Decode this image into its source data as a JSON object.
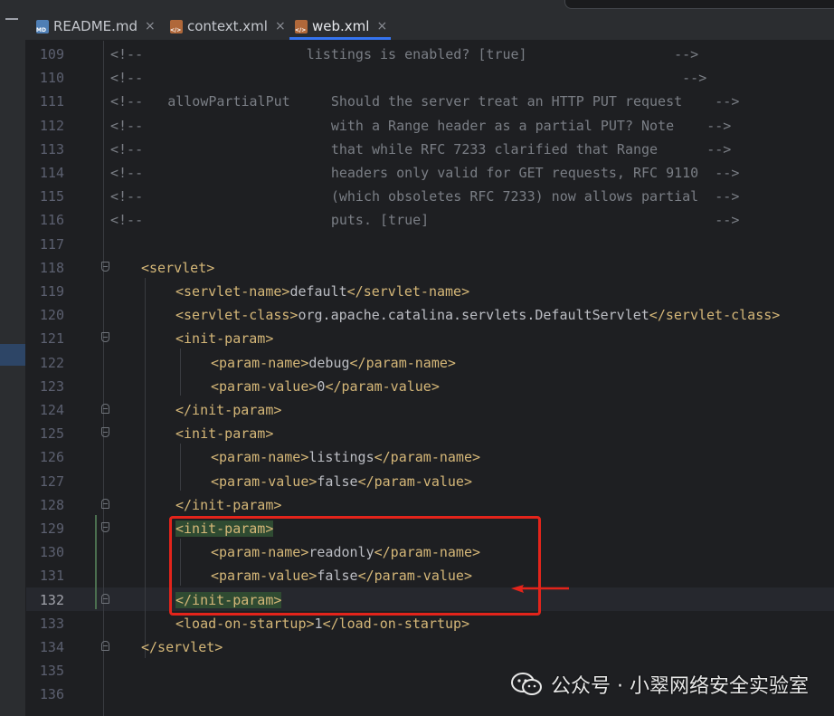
{
  "tabs": [
    {
      "label": "README.md",
      "icon": "markdown-file-icon",
      "badge": "MD",
      "color": "#6aa1d8"
    },
    {
      "label": "context.xml",
      "icon": "xml-file-icon",
      "badge": "</>",
      "color": "#c77b3b"
    },
    {
      "label": "web.xml",
      "icon": "xml-file-icon",
      "badge": "</>",
      "color": "#c77b3b",
      "active": true
    }
  ],
  "lines": [
    {
      "n": "109",
      "c": "<!--                    listings is enabled? [true]                  -->"
    },
    {
      "n": "110",
      "c": "<!--                                                                  -->"
    },
    {
      "n": "111",
      "c": "<!--   allowPartialPut     Should the server treat an HTTP PUT request    -->"
    },
    {
      "n": "112",
      "c": "<!--                       with a Range header as a partial PUT? Note    -->"
    },
    {
      "n": "113",
      "c": "<!--                       that while RFC 7233 clarified that Range      -->"
    },
    {
      "n": "114",
      "c": "<!--                       headers only valid for GET requests, RFC 9110  -->"
    },
    {
      "n": "115",
      "c": "<!--                       (which obsoletes RFC 7233) now allows partial  -->"
    },
    {
      "n": "116",
      "c": "<!--                       puts. [true]                                   -->"
    },
    {
      "n": "117",
      "c": ""
    },
    {
      "n": "118",
      "c": "<servlet>"
    },
    {
      "n": "119",
      "c": "<servlet-name>default</servlet-name>"
    },
    {
      "n": "120",
      "c": "<servlet-class>org.apache.catalina.servlets.DefaultServlet</servlet-class>"
    },
    {
      "n": "121",
      "c": "<init-param>"
    },
    {
      "n": "122",
      "c": "<param-name>debug</param-name>"
    },
    {
      "n": "123",
      "c": "<param-value>0</param-value>"
    },
    {
      "n": "124",
      "c": "</init-param>"
    },
    {
      "n": "125",
      "c": "<init-param>"
    },
    {
      "n": "126",
      "c": "<param-name>listings</param-name>"
    },
    {
      "n": "127",
      "c": "<param-value>false</param-value>"
    },
    {
      "n": "128",
      "c": "</init-param>"
    },
    {
      "n": "129",
      "c": "<init-param>"
    },
    {
      "n": "130",
      "c": "<param-name>readonly</param-name>"
    },
    {
      "n": "131",
      "c": "<param-value>false</param-value>"
    },
    {
      "n": "132",
      "c": "</init-param>"
    },
    {
      "n": "133",
      "c": "<load-on-startup>1</load-on-startup>"
    },
    {
      "n": "134",
      "c": "</servlet>"
    },
    {
      "n": "135",
      "c": ""
    },
    {
      "n": "136",
      "c": ""
    }
  ],
  "current_line": "132",
  "watermark": {
    "text": "公众号 · 小翠网络安全实验室",
    "icon": "wechat-icon"
  },
  "colors": {
    "annotation": "#e3241b",
    "tag": "#d5b778",
    "comment": "#7a7e85",
    "text": "#bcbec4",
    "accent": "#3574f0"
  }
}
